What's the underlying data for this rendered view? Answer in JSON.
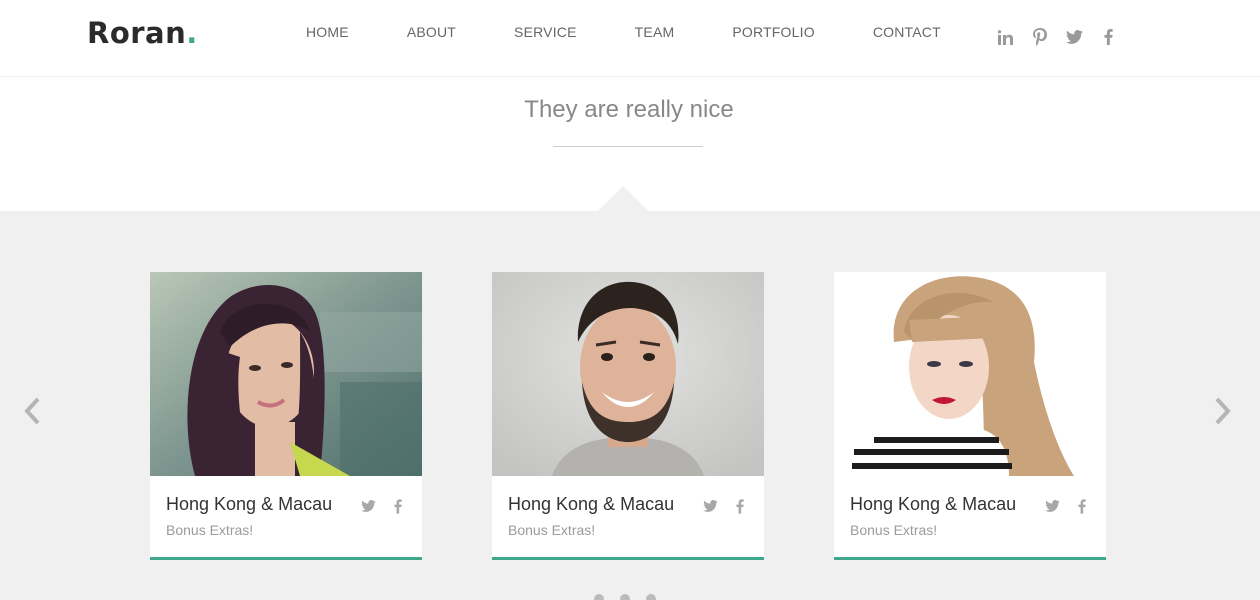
{
  "brand": {
    "name": "Roran",
    "dot": ".",
    "accent": "#3fa78e"
  },
  "nav": [
    {
      "label": "HOME"
    },
    {
      "label": "ABOUT"
    },
    {
      "label": "SERVICE"
    },
    {
      "label": "TEAM"
    },
    {
      "label": "PORTFOLIO"
    },
    {
      "label": "CONTACT"
    }
  ],
  "header_social": [
    "linkedin-icon",
    "pinterest-icon",
    "twitter-icon",
    "facebook-icon"
  ],
  "section": {
    "title": "They are really nice"
  },
  "cards": [
    {
      "name": "Hong Kong & Macau",
      "subtitle": "Bonus Extras!",
      "photo": "woman-dark-hair-photo"
    },
    {
      "name": "Hong Kong & Macau",
      "subtitle": "Bonus Extras!",
      "photo": "smiling-bearded-man-photo"
    },
    {
      "name": "Hong Kong & Macau",
      "subtitle": "Bonus Extras!",
      "photo": "blonde-woman-photo"
    }
  ],
  "carousel": {
    "prev_icon": "chevron-left-icon",
    "next_icon": "chevron-right-icon"
  }
}
